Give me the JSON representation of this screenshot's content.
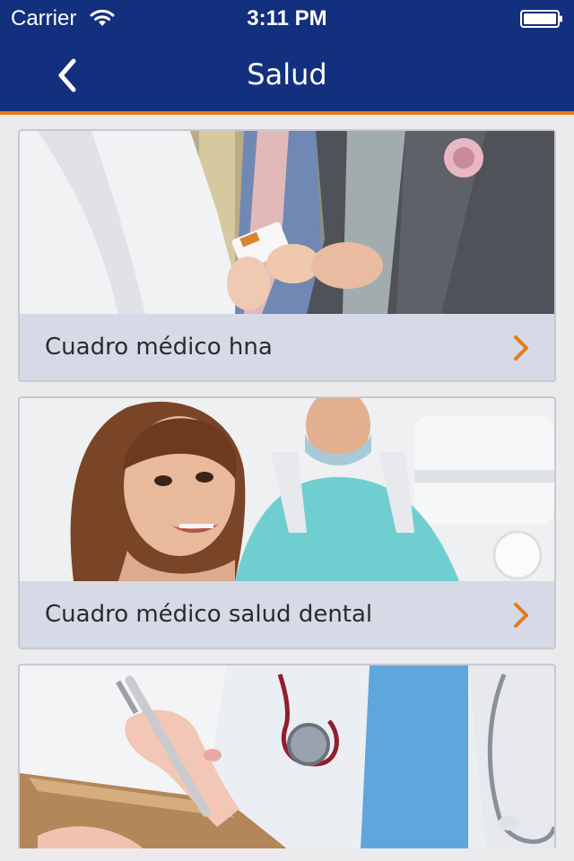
{
  "status_bar": {
    "carrier": "Carrier",
    "time": "3:11 PM"
  },
  "nav": {
    "title": "Salud",
    "back_icon": "chevron-left-icon"
  },
  "colors": {
    "nav_bg": "#13307f",
    "accent": "#e57b1e",
    "card_label_bg": "#d6d9e6"
  },
  "cards": [
    {
      "label": "Cuadro médico hna",
      "image": "doctor-patient-card-photo",
      "icon": "chevron-right-icon"
    },
    {
      "label": "Cuadro médico salud dental",
      "image": "dental-patient-photo",
      "icon": "chevron-right-icon"
    },
    {
      "label": "",
      "image": "doctor-writing-clipboard-photo"
    }
  ]
}
